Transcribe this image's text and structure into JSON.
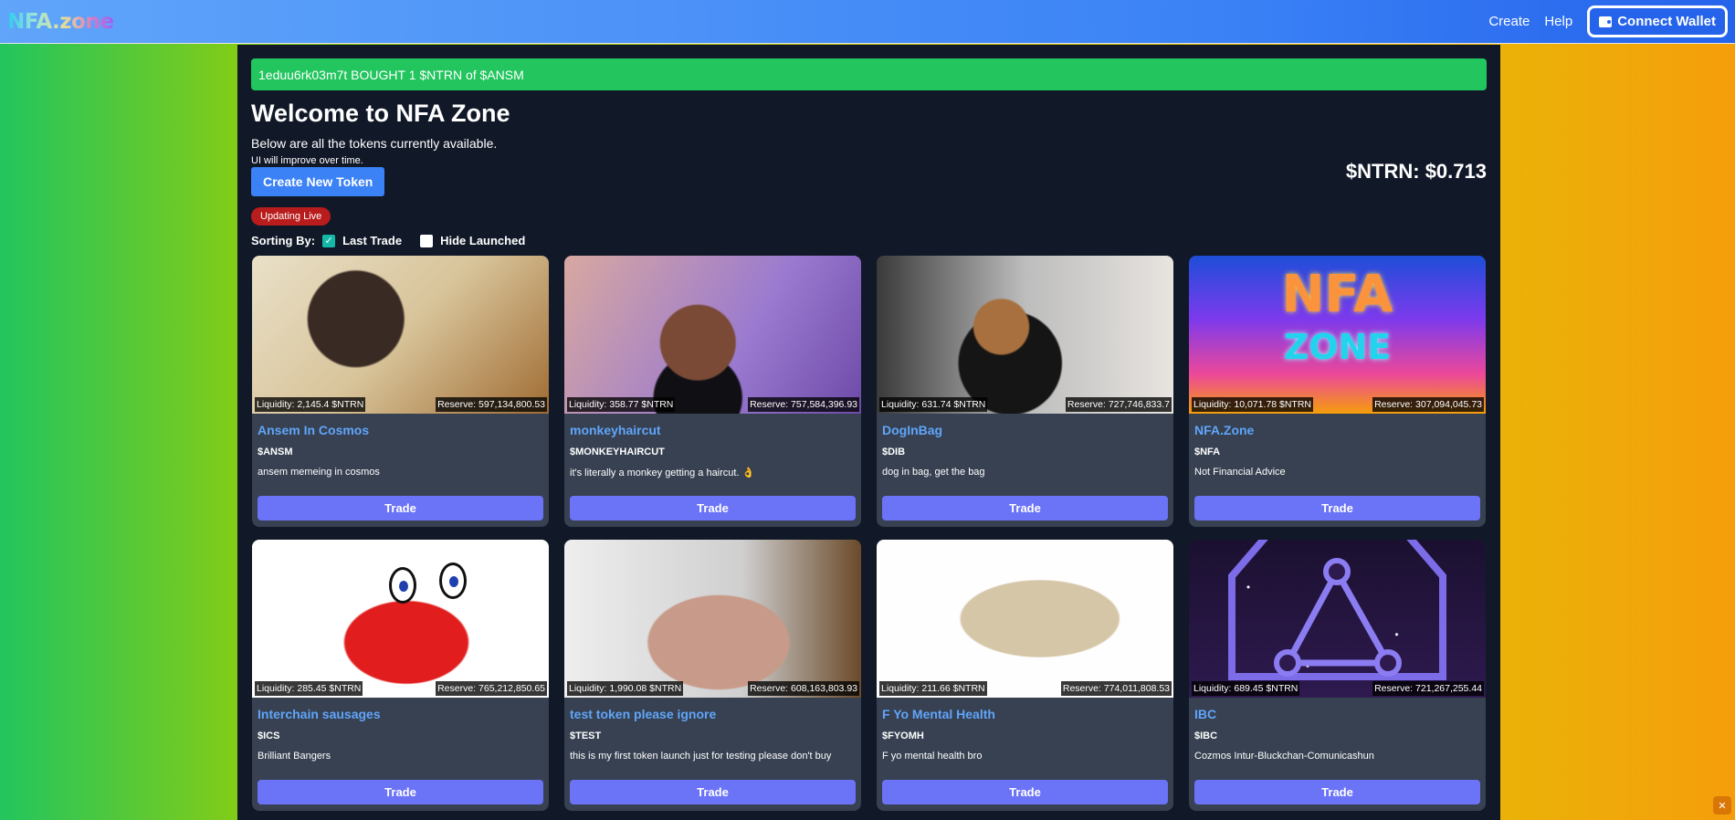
{
  "header": {
    "logo": "NFA.zone",
    "nav": {
      "create": "Create",
      "help": "Help"
    },
    "wallet_button": "Connect Wallet"
  },
  "ticker": "1eduu6rk03m7t BOUGHT 1 $NTRN of $ANSM",
  "welcome": {
    "title": "Welcome to NFA Zone",
    "subtitle": "Below are all the tokens currently available.",
    "note": "UI will improve over time."
  },
  "price": "$NTRN: $0.713",
  "create_button": "Create New Token",
  "live_badge": "Updating Live",
  "sorting": {
    "label": "Sorting By:",
    "last_trade": "Last Trade",
    "last_trade_checked": true,
    "hide_launched": "Hide Launched",
    "hide_launched_checked": false
  },
  "tokens": [
    {
      "liquidity": "Liquidity: 2,145.4 $NTRN",
      "reserve": "Reserve: 597,134,800.53",
      "name": "Ansem In Cosmos",
      "symbol": "$ANSM",
      "description": "ansem memeing in cosmos",
      "trade": "Trade"
    },
    {
      "liquidity": "Liquidity: 358.77 $NTRN",
      "reserve": "Reserve: 757,584,396.93",
      "name": "monkeyhaircut",
      "symbol": "$MONKEYHAIRCUT",
      "description": "it's literally a monkey getting a haircut. 👌",
      "trade": "Trade"
    },
    {
      "liquidity": "Liquidity: 631.74 $NTRN",
      "reserve": "Reserve: 727,746,833.7",
      "name": "DogInBag",
      "symbol": "$DIB",
      "description": "dog in bag, get the bag",
      "trade": "Trade"
    },
    {
      "liquidity": "Liquidity: 10,071.78 $NTRN",
      "reserve": "Reserve: 307,094,045.73",
      "name": "NFA.Zone",
      "symbol": "$NFA",
      "description": "Not Financial Advice",
      "trade": "Trade"
    },
    {
      "liquidity": "Liquidity: 285.45 $NTRN",
      "reserve": "Reserve: 765,212,850.65",
      "name": "Interchain sausages",
      "symbol": "$ICS",
      "description": "Brilliant Bangers",
      "trade": "Trade"
    },
    {
      "liquidity": "Liquidity: 1,990.08 $NTRN",
      "reserve": "Reserve: 608,163,803.93",
      "name": "test token please ignore",
      "symbol": "$TEST",
      "description": "this is my first token launch just for testing please don't buy",
      "trade": "Trade"
    },
    {
      "liquidity": "Liquidity: 211.66 $NTRN",
      "reserve": "Reserve: 774,011,808.53",
      "name": "F Yo Mental Health",
      "symbol": "$FYOMH",
      "description": "F yo mental health bro",
      "trade": "Trade"
    },
    {
      "liquidity": "Liquidity: 689.45 $NTRN",
      "reserve": "Reserve: 721,267,255.44",
      "name": "IBC",
      "symbol": "$IBC",
      "description": "Cozmos Intur-Bluckchan-Comunicashun",
      "trade": "Trade"
    }
  ],
  "nfa_art": {
    "line1": "NFA",
    "line2": "ZONE"
  }
}
